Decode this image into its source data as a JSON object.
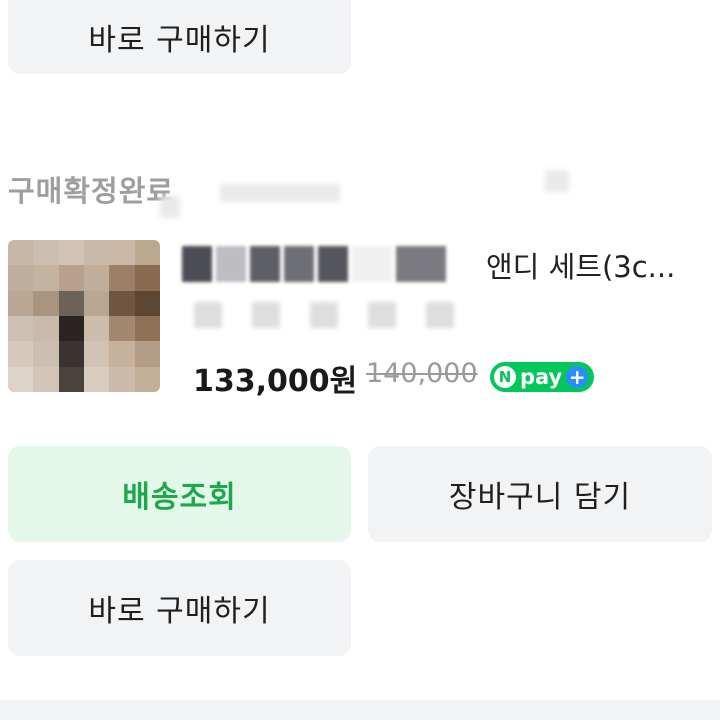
{
  "top_button": {
    "label": "바로 구매하기"
  },
  "order": {
    "status": "구매확정완료",
    "product": {
      "name": "앤디 세트(3c...",
      "price": "133,000원",
      "original_price": "140,000",
      "npay_badge": {
        "n": "N",
        "label": "pay",
        "plus": "+"
      }
    }
  },
  "actions": {
    "track": "배송조회",
    "cart": "장바구니 담기",
    "buy_now": "바로 구매하기"
  },
  "colors": {
    "accent_green": "#1ea84e",
    "button_bg": "#f2f3f5",
    "green_button_bg": "#e4f8ea",
    "npay_green": "#03c75a"
  }
}
